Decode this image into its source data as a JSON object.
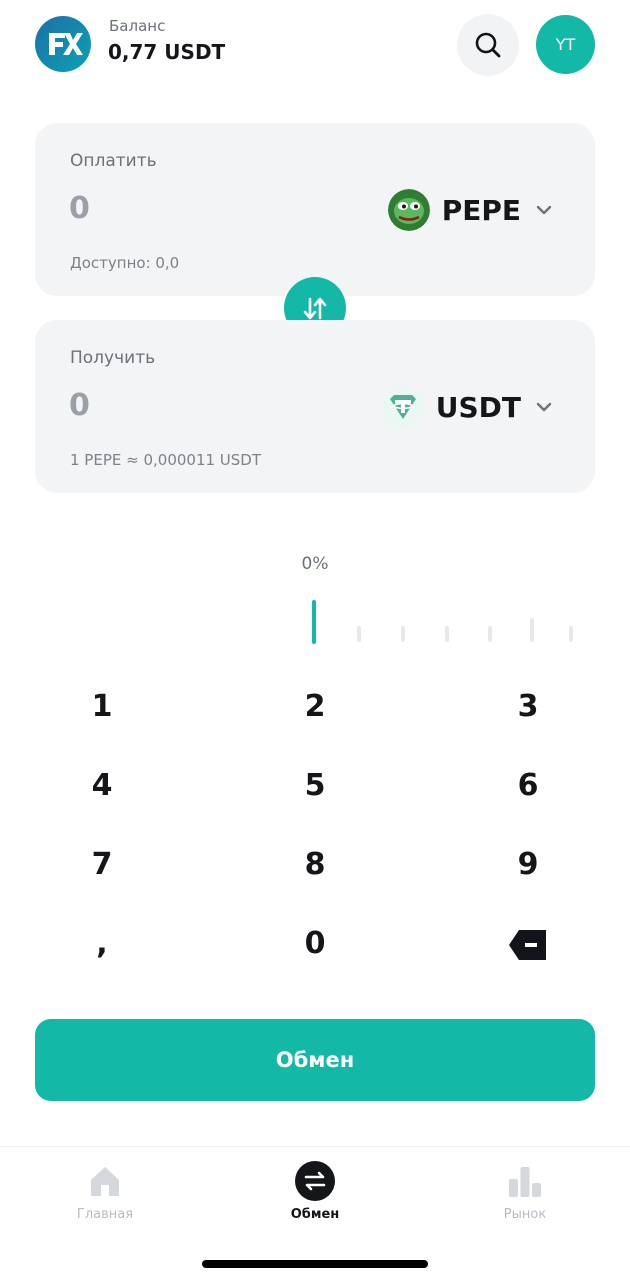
{
  "header": {
    "balance_label": "Баланс",
    "balance_value": "0,77 USDT",
    "avatar_initials": "YT",
    "logo_icon": "fk-logo-icon",
    "search_icon": "search-icon"
  },
  "pay_card": {
    "label": "Оплатить",
    "amount": "0",
    "token": "PEPE",
    "available": "Доступно: 0,0"
  },
  "receive_card": {
    "label": "Получить",
    "amount": "0",
    "token": "USDT",
    "rate": "1 PEPE ≈ 0,000011 USDT"
  },
  "swap_icon": "swap-arrows-icon",
  "percent": {
    "label": "0%",
    "value": 0
  },
  "keypad": {
    "keys": [
      "1",
      "2",
      "3",
      "4",
      "5",
      "6",
      "7",
      "8",
      "9",
      ",",
      "0"
    ],
    "backspace_icon": "backspace-icon"
  },
  "exchange_button": "Обмен",
  "nav": {
    "items": [
      {
        "label": "Главная",
        "icon": "home-icon"
      },
      {
        "label": "Обмен",
        "icon": "exchange-icon"
      },
      {
        "label": "Рынок",
        "icon": "bar-chart-icon"
      }
    ],
    "active_index": 1
  },
  "colors": {
    "accent": "#14b8a6",
    "card_bg": "#f3f4f6",
    "text_primary": "#14161a",
    "text_secondary": "#6c717a"
  }
}
